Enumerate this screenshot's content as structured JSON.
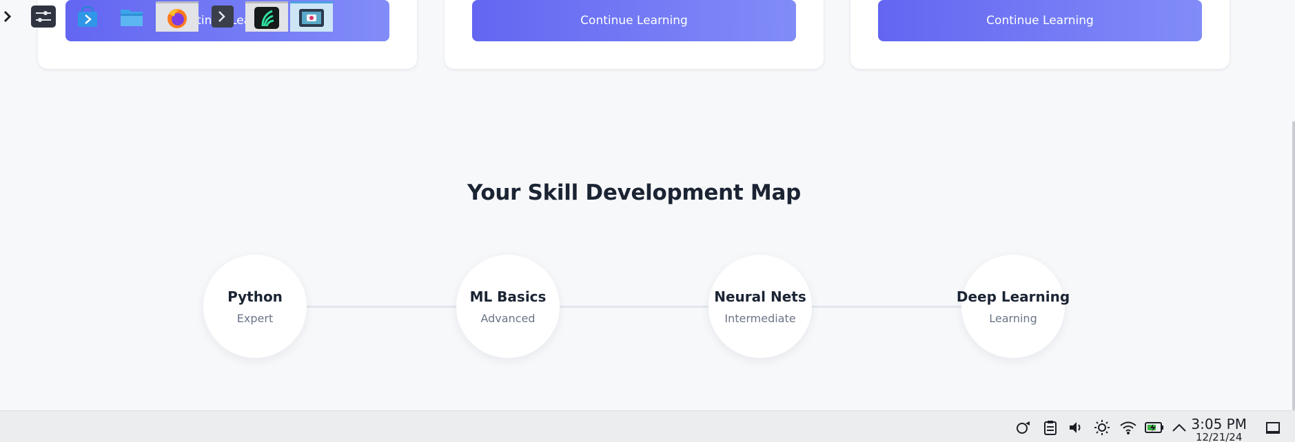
{
  "courses": [
    {
      "cta_label": "Continue Learning"
    },
    {
      "cta_label": "Continue Learning"
    },
    {
      "cta_label": "Continue Learning"
    }
  ],
  "skill_map": {
    "title": "Your Skill Development Map",
    "skills": [
      {
        "name": "Python",
        "level": "Expert"
      },
      {
        "name": "ML Basics",
        "level": "Advanced"
      },
      {
        "name": "Neural Nets",
        "level": "Intermediate"
      },
      {
        "name": "Deep Learning",
        "level": "Learning"
      }
    ]
  },
  "taskbar": {
    "apps": [
      "application-launcher-icon",
      "settings-icon",
      "software-store-icon",
      "file-manager-icon",
      "firefox-icon",
      "terminal-icon",
      "app-icon",
      "screenshot-icon"
    ],
    "tray": [
      "network-icon",
      "clipboard-icon",
      "volume-icon",
      "brightness-icon",
      "wifi-icon",
      "battery-icon",
      "tray-expand-icon"
    ],
    "time": "3:05 PM",
    "date": "12/21/24"
  },
  "colors": {
    "accent_start": "#6366f1",
    "accent_end": "#818cf8",
    "background": "#f7f8fa"
  }
}
